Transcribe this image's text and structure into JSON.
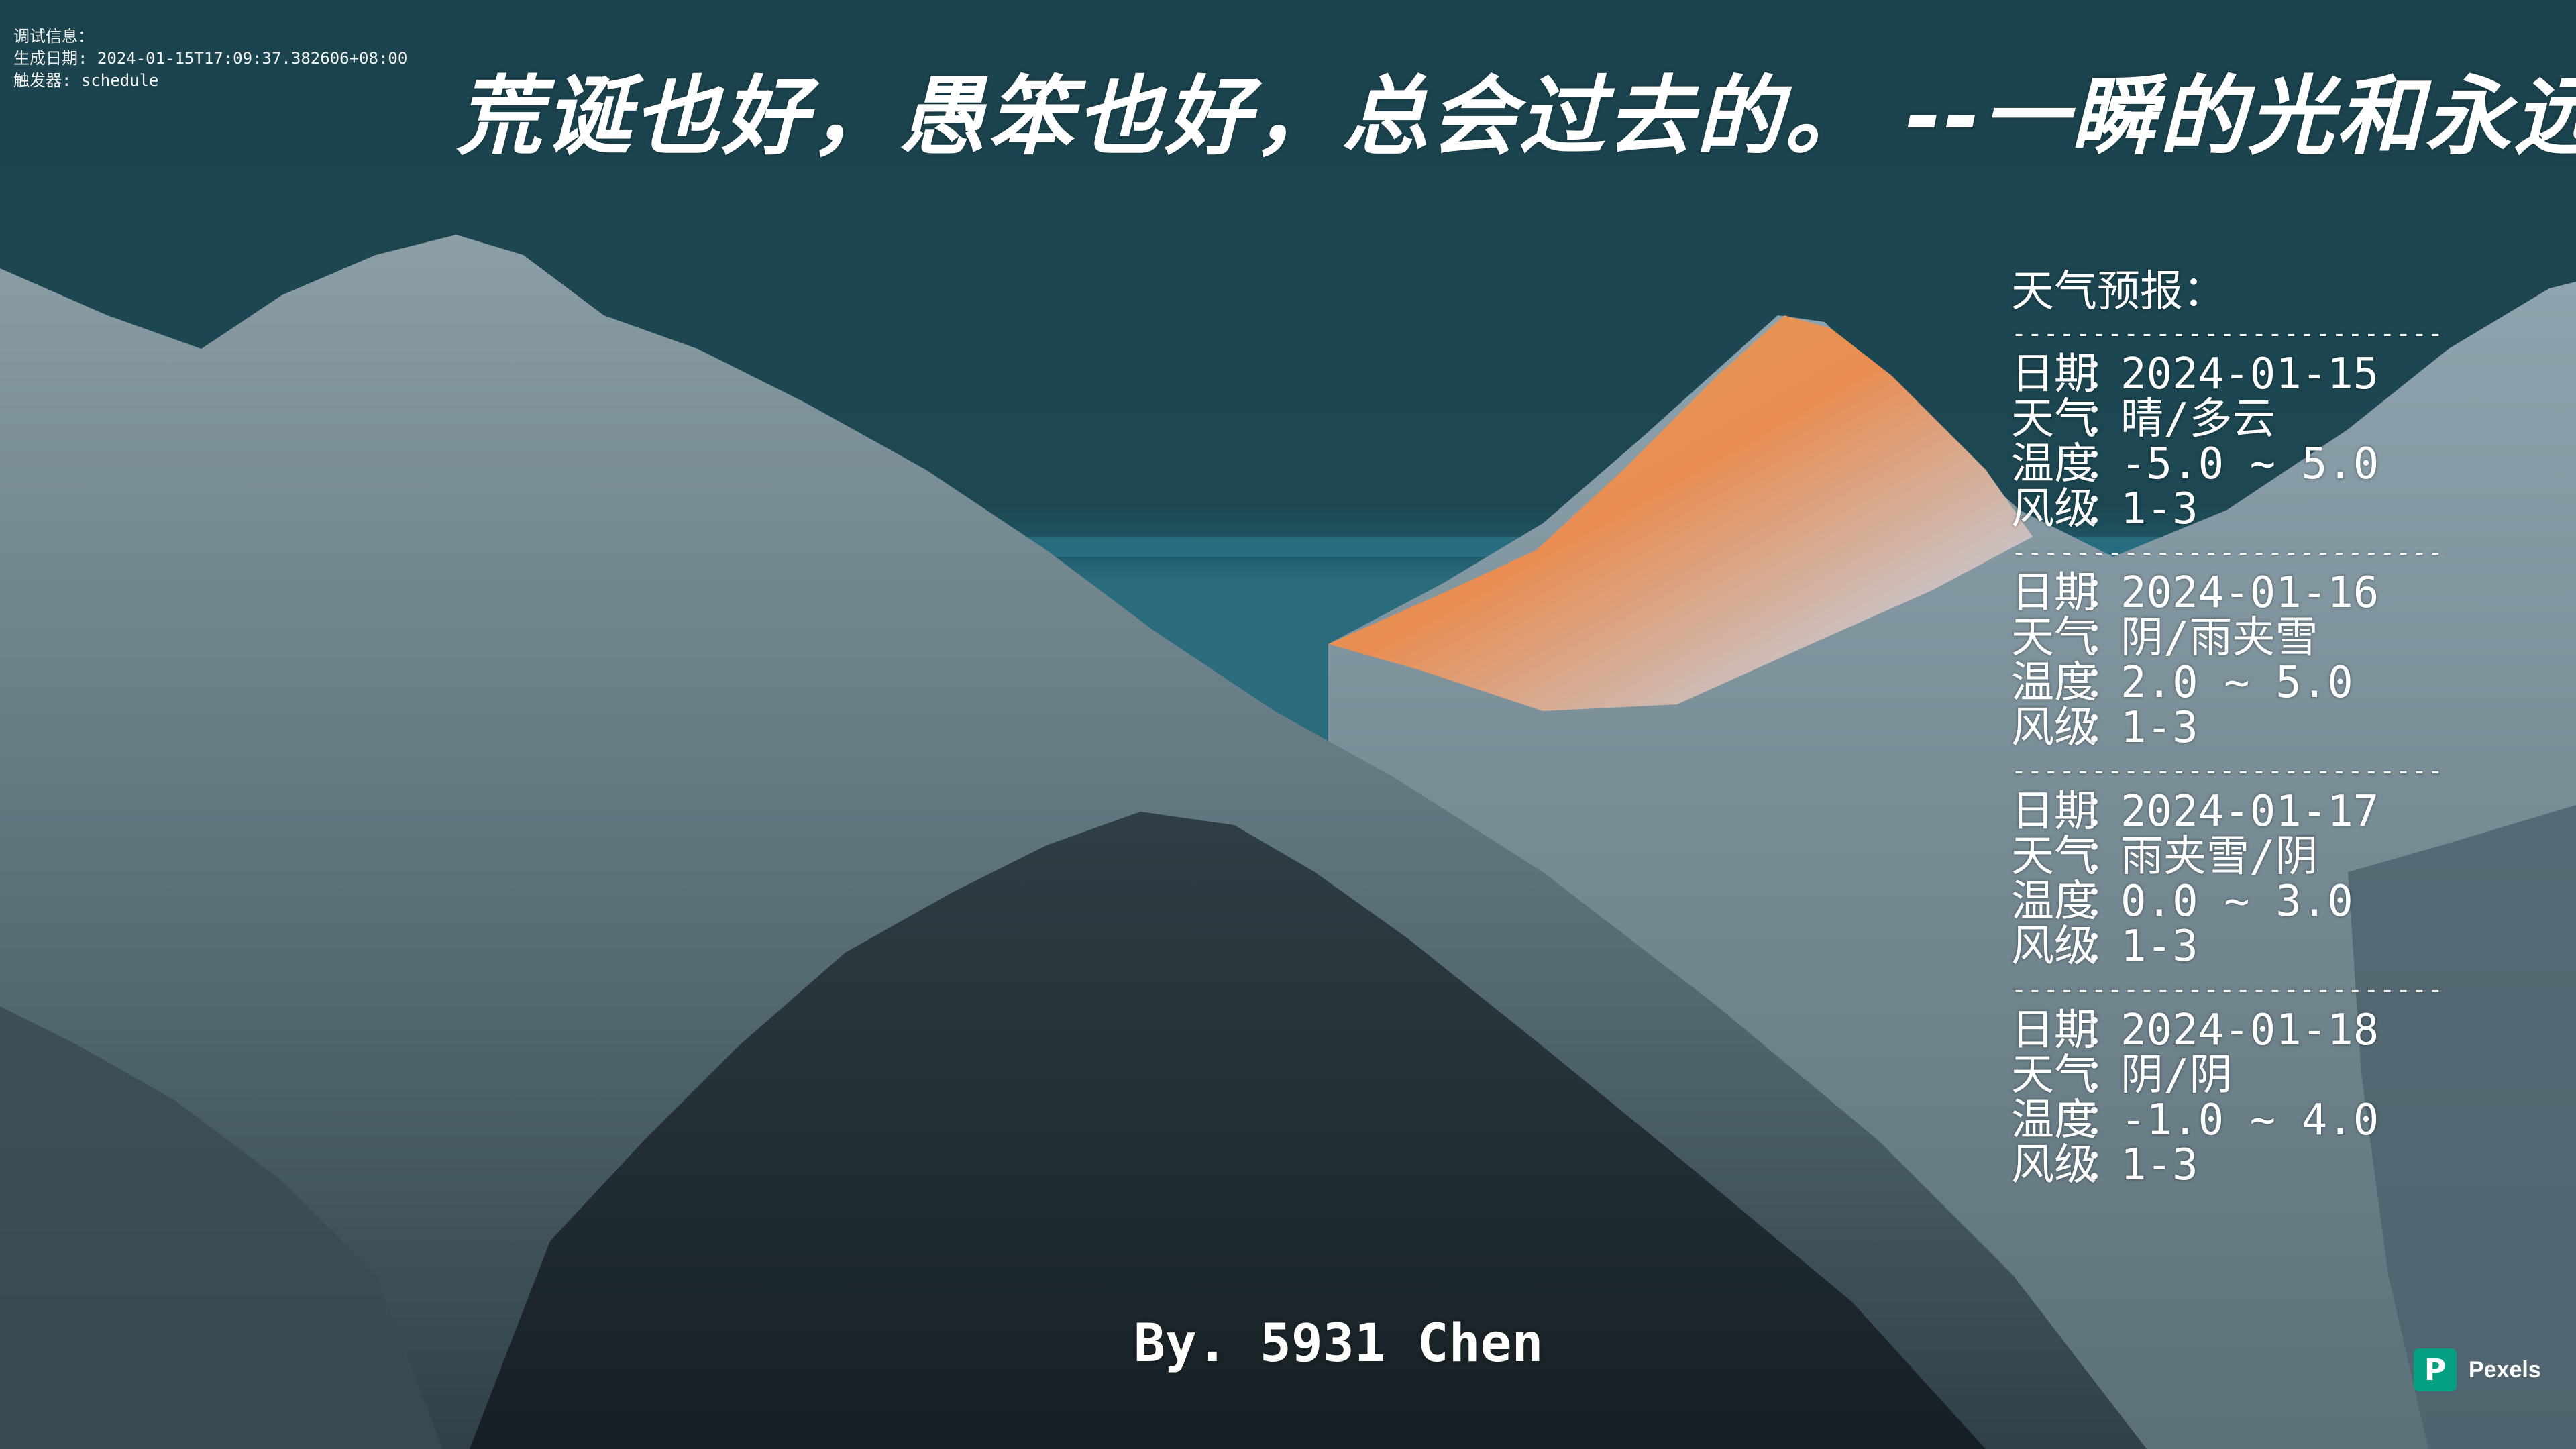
{
  "debug": {
    "line1": "调试信息：",
    "line2": "生成日期: 2024-01-15T17:09:37.382606+08:00",
    "line3": "触发器: schedule"
  },
  "quote": "荒诞也好，愚笨也好，总会过去的。  --一瞬的光和永远",
  "weather": {
    "title": "天气预报：",
    "separator": "----------------------------",
    "key_date": "日期",
    "key_weather": "天气",
    "key_temp": "温度",
    "key_wind": "风级",
    "colon": "：",
    "days": [
      {
        "date": "2024-01-15",
        "weather": "晴/多云",
        "temp": "-5.0 ~ 5.0",
        "wind": "1-3"
      },
      {
        "date": "2024-01-16",
        "weather": "阴/雨夹雪",
        "temp": "2.0 ~ 5.0",
        "wind": "1-3"
      },
      {
        "date": "2024-01-17",
        "weather": "雨夹雪/阴",
        "temp": "0.0 ~ 3.0",
        "wind": "1-3"
      },
      {
        "date": "2024-01-18",
        "weather": "阴/阴",
        "temp": "-1.0 ~ 4.0",
        "wind": "1-3"
      }
    ]
  },
  "signature": "By. 5931 Chen",
  "credit": {
    "logo": "P",
    "name": "Pexels"
  },
  "colors": {
    "sky": "#1d4752",
    "pexels_green": "#05a081",
    "sunlit_peak": "#e6985c"
  }
}
